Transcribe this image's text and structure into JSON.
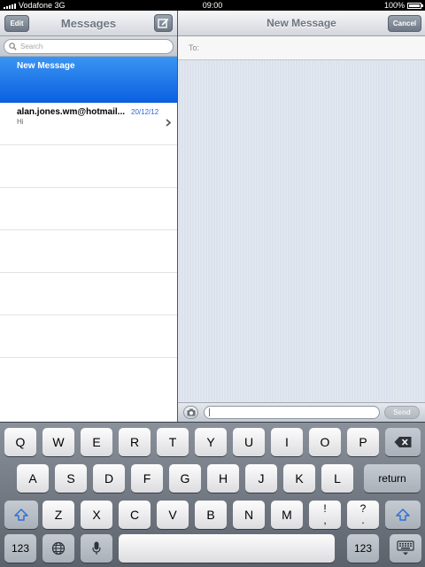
{
  "status_bar": {
    "carrier": "Vodafone 3G",
    "time": "09:00",
    "battery": "100%"
  },
  "messages_panel": {
    "title": "Messages",
    "edit_label": "Edit",
    "compose_icon": "compose-icon",
    "search_placeholder": "Search",
    "new_message_label": "New Message",
    "conversations": [
      {
        "name": "alan.jones.wm@hotmail...",
        "date": "20/12/12",
        "preview": "Hi"
      }
    ]
  },
  "new_message": {
    "title": "New Message",
    "cancel_label": "Cancel",
    "to_label": "To:",
    "send_label": "Send",
    "camera_icon": "camera-icon"
  },
  "keyboard": {
    "row1": [
      "Q",
      "W",
      "E",
      "R",
      "T",
      "Y",
      "U",
      "I",
      "O",
      "P"
    ],
    "row2": [
      "A",
      "S",
      "D",
      "F",
      "G",
      "H",
      "J",
      "K",
      "L"
    ],
    "row3": [
      "Z",
      "X",
      "C",
      "V",
      "B",
      "N",
      "M"
    ],
    "return_label": "return",
    "numbers_label": "123",
    "exclam_top": "!",
    "exclam_bottom": ",",
    "question_top": "?",
    "question_bottom": ".",
    "icons": [
      "backspace-icon",
      "shift-icon",
      "globe-icon",
      "microphone-icon",
      "keyboard-dismiss-icon"
    ]
  }
}
